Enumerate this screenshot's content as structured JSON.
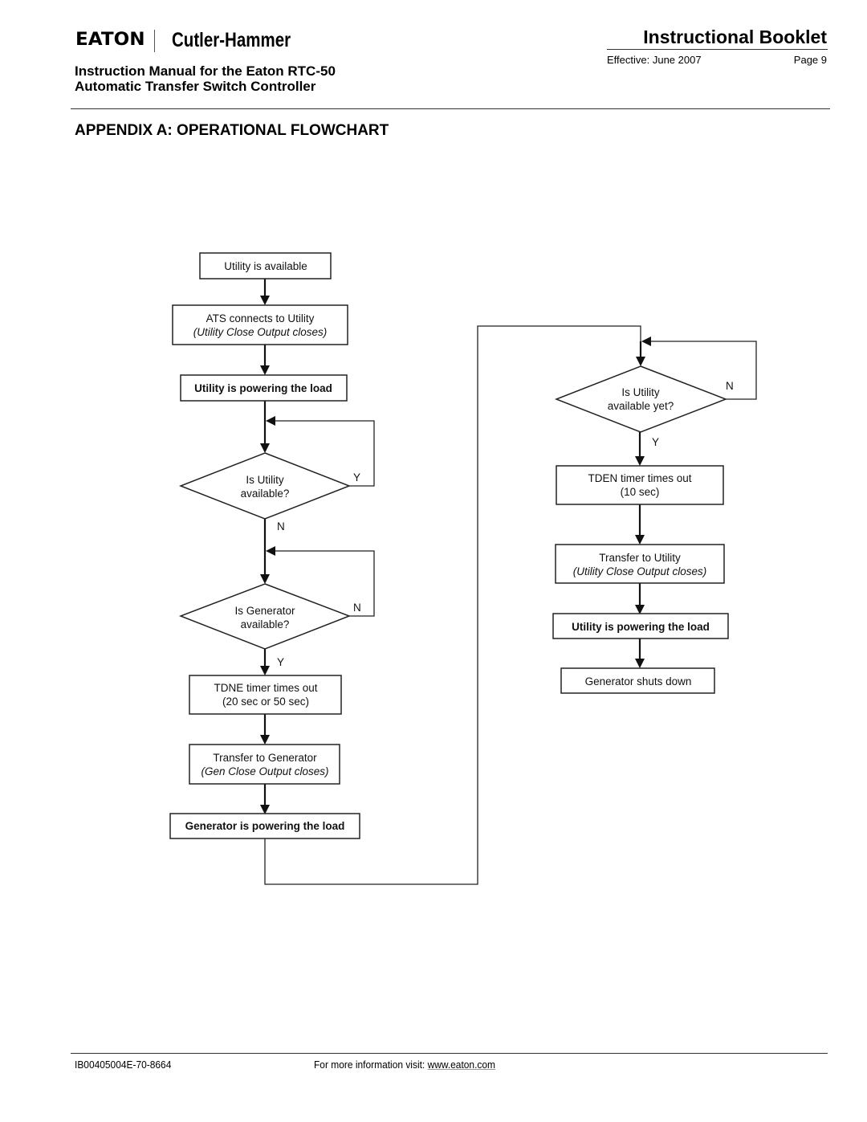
{
  "header": {
    "brand_logo": "EATON",
    "brand_name": "Cutler-Hammer",
    "manual_title_line1": "Instruction Manual for the Eaton RTC-50",
    "manual_title_line2": "Automatic Transfer Switch Controller",
    "booklet_title": "Instructional Booklet",
    "effective": "Effective: June 2007",
    "page": "Page 9"
  },
  "section_title": "APPENDIX A:  OPERATIONAL FLOWCHART",
  "flowchart": {
    "nodes": {
      "utility_available": {
        "type": "process",
        "lines": [
          "Utility is available"
        ]
      },
      "ats_connects": {
        "type": "process",
        "lines": [
          "ATS connects to Utility"
        ],
        "note": "(Utility Close Output closes)"
      },
      "utility_powering_1": {
        "type": "state",
        "lines": [
          "Utility is powering the load"
        ]
      },
      "is_utility_available": {
        "type": "decision",
        "lines": [
          "Is Utility",
          "available?"
        ],
        "yes_label": "Y",
        "no_label": "N"
      },
      "is_generator_available": {
        "type": "decision",
        "lines": [
          "Is Generator",
          "available?"
        ],
        "yes_label": "Y",
        "no_label": "N"
      },
      "tdne_timer": {
        "type": "process",
        "lines": [
          "TDNE timer times out",
          "(20 sec or 50 sec)"
        ]
      },
      "transfer_to_generator": {
        "type": "process",
        "lines": [
          "Transfer to Generator"
        ],
        "note": "(Gen Close Output closes)"
      },
      "generator_powering": {
        "type": "state",
        "lines": [
          "Generator is powering the load"
        ]
      },
      "is_utility_available_yet": {
        "type": "decision",
        "lines": [
          "Is Utility",
          "available yet?"
        ],
        "yes_label": "Y",
        "no_label": "N"
      },
      "tden_timer": {
        "type": "process",
        "lines": [
          "TDEN timer times out",
          "(10 sec)"
        ]
      },
      "transfer_to_utility": {
        "type": "process",
        "lines": [
          "Transfer to Utility"
        ],
        "note": "(Utility Close Output closes)"
      },
      "utility_powering_2": {
        "type": "state",
        "lines": [
          "Utility is powering the load"
        ]
      },
      "generator_shuts_down": {
        "type": "process",
        "lines": [
          "Generator shuts down"
        ]
      }
    },
    "edges": [
      [
        "utility_available",
        "ats_connects",
        ""
      ],
      [
        "ats_connects",
        "utility_powering_1",
        ""
      ],
      [
        "utility_powering_1",
        "is_utility_available",
        ""
      ],
      [
        "is_utility_available",
        "is_utility_available",
        "Y"
      ],
      [
        "is_utility_available",
        "is_generator_available",
        "N"
      ],
      [
        "is_generator_available",
        "is_generator_available",
        "N"
      ],
      [
        "is_generator_available",
        "tdne_timer",
        "Y"
      ],
      [
        "tdne_timer",
        "transfer_to_generator",
        ""
      ],
      [
        "transfer_to_generator",
        "generator_powering",
        ""
      ],
      [
        "generator_powering",
        "is_utility_available_yet",
        ""
      ],
      [
        "is_utility_available_yet",
        "is_utility_available_yet",
        "N"
      ],
      [
        "is_utility_available_yet",
        "tden_timer",
        "Y"
      ],
      [
        "tden_timer",
        "transfer_to_utility",
        ""
      ],
      [
        "transfer_to_utility",
        "utility_powering_2",
        ""
      ],
      [
        "utility_powering_2",
        "generator_shuts_down",
        ""
      ]
    ]
  },
  "footer": {
    "doc_number": "IB00405004E-70-8664",
    "info_prefix": "For more information visit: ",
    "info_link": "www.eaton.com"
  }
}
